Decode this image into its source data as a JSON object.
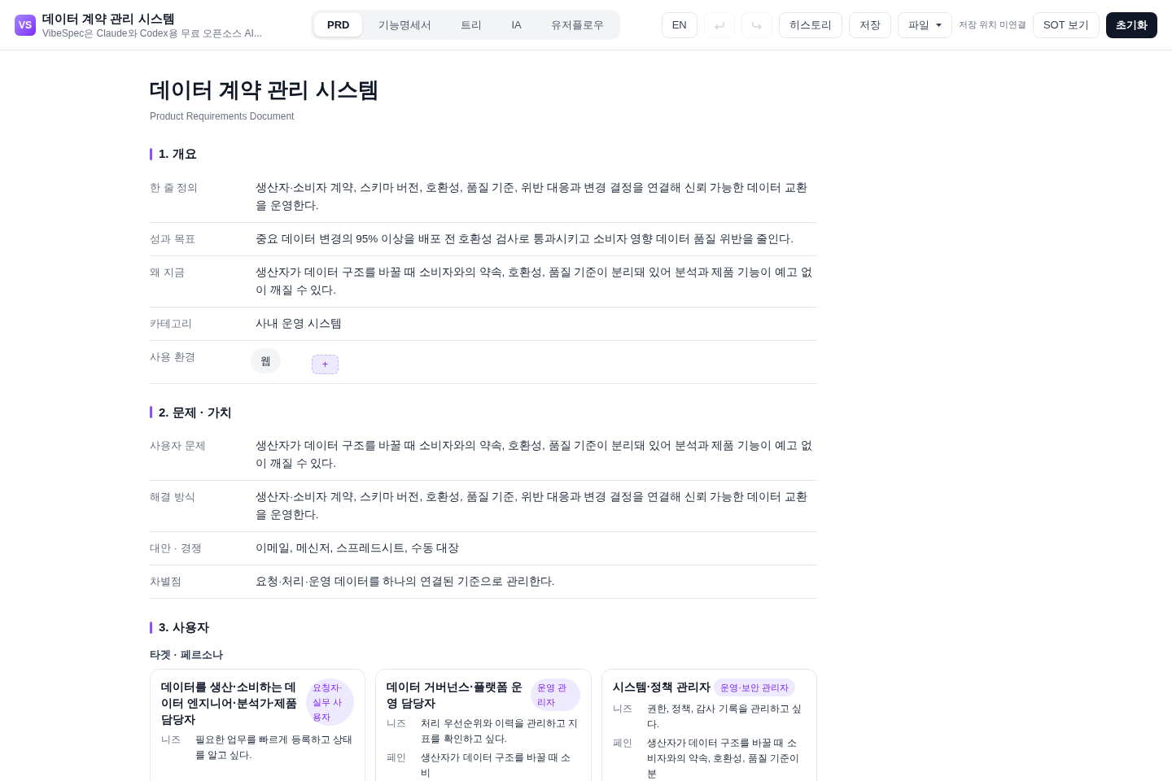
{
  "header": {
    "logo": "VS",
    "title": "데이터 계약 관리 시스템",
    "subtitle": "VibeSpec은 Claude와 Codex용 무료 오픈소스 AI..."
  },
  "tabs": [
    {
      "label": "PRD",
      "selected": true
    },
    {
      "label": "기능명세서",
      "selected": false
    },
    {
      "label": "트리",
      "selected": false
    },
    {
      "label": "IA",
      "selected": false
    },
    {
      "label": "유저플로우",
      "selected": false
    }
  ],
  "toolbar": {
    "language": "EN",
    "undo_disabled": true,
    "redo_disabled": true,
    "history": "히스토리",
    "save": "저장",
    "file": "파일",
    "save_status": "저장 위치 미연결",
    "sot": "SOT 보기",
    "reset": "초기화"
  },
  "document": {
    "title": "데이터 계약 관리 시스템",
    "subtitle": "Product Requirements Document",
    "sections": [
      {
        "heading": "1. 개요",
        "rows": [
          {
            "kind": "text",
            "label": "한 줄 정의",
            "value": "생산자·소비자 계약, 스키마 버전, 호환성, 품질 기준, 위반 대응과 변경 결정을 연결해 신뢰 가능한 데이터 교환을 운영한다."
          },
          {
            "kind": "text",
            "label": "성과 목표",
            "value": "중요 데이터 변경의 95% 이상을 배포 전 호환성 검사로 통과시키고 소비자 영향 데이터 품질 위반을 줄인다."
          },
          {
            "kind": "text",
            "label": "왜 지금",
            "value": "생산자가 데이터 구조를 바꿀 때 소비자와의 약속, 호환성, 품질 기준이 분리돼 있어 분석과 제품 기능이 예고 없이 깨질 수 있다."
          },
          {
            "kind": "text",
            "label": "카테고리",
            "value": "사내 운영 시스템"
          },
          {
            "kind": "chips",
            "label": "사용 환경",
            "chips": [
              "웹"
            ],
            "add": "+"
          }
        ]
      },
      {
        "heading": "2. 문제 · 가치",
        "rows": [
          {
            "kind": "text",
            "label": "사용자 문제",
            "value": "생산자가 데이터 구조를 바꿀 때 소비자와의 약속, 호환성, 품질 기준이 분리돼 있어 분석과 제품 기능이 예고 없이 깨질 수 있다."
          },
          {
            "kind": "text",
            "label": "해결 방식",
            "value": "생산자·소비자 계약, 스키마 버전, 호환성, 품질 기준, 위반 대응과 변경 결정을 연결해 신뢰 가능한 데이터 교환을 운영한다."
          },
          {
            "kind": "text",
            "label": "대안 · 경쟁",
            "value": "이메일, 메신저, 스프레드시트, 수동 대장"
          },
          {
            "kind": "text",
            "label": "차별점",
            "value": "요청·처리·운영 데이터를 하나의 연결된 기준으로 관리한다."
          }
        ]
      },
      {
        "heading": "3. 사용자",
        "subheading": "타겟 · 페르소나",
        "personas": [
          {
            "name": "데이터를 생산·소비하는 데이터 엔지니어·분석가·제품 담당자",
            "role": "요청자·실무 사용자",
            "fields": [
              {
                "label": "니즈",
                "value": "필요한 업무를 빠르게 등록하고 상태를 알고 싶다."
              }
            ]
          },
          {
            "name": "데이터 거버넌스·플랫폼 운영 담당자",
            "role": "운영 관리자",
            "fields": [
              {
                "label": "니즈",
                "value": "처리 우선순위와 이력을 관리하고 지표를 확인하고 싶다."
              },
              {
                "label": "페인",
                "value": "생산자가 데이터 구조를 바꿀 때 소비"
              }
            ]
          },
          {
            "name": "시스템·정책 관리자",
            "role": "운영·보안 관리자",
            "fields": [
              {
                "label": "니즈",
                "value": "권한, 정책, 감사 기록을 관리하고 싶다."
              },
              {
                "label": "페인",
                "value": "생산자가 데이터 구조를 바꿀 때 소비자와의 약속, 호환성, 품질 기준이 분"
              }
            ]
          }
        ]
      }
    ]
  }
}
